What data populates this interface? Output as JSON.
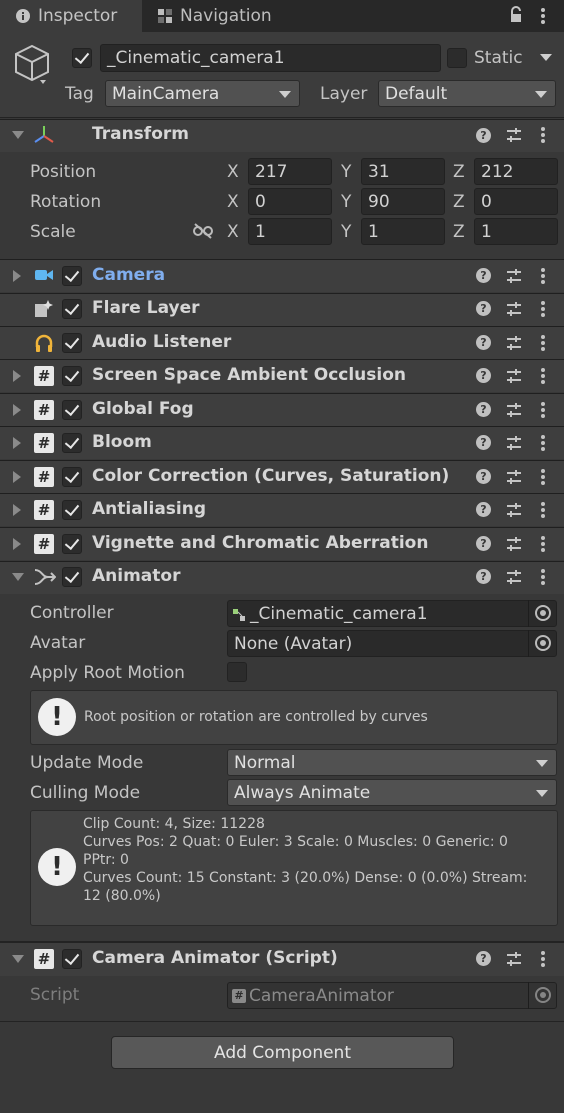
{
  "tabs": [
    {
      "label": "Inspector",
      "icon": "info-icon"
    },
    {
      "label": "Navigation",
      "icon": "navigation-icon"
    }
  ],
  "header": {
    "object_name": "_Cinematic_camera1",
    "static_label": "Static",
    "tag_label": "Tag",
    "tag_value": "MainCamera",
    "layer_label": "Layer",
    "layer_value": "Default"
  },
  "transform": {
    "title": "Transform",
    "rows": [
      {
        "label": "Position",
        "x": "217",
        "y": "31",
        "z": "212"
      },
      {
        "label": "Rotation",
        "x": "0",
        "y": "90",
        "z": "0"
      },
      {
        "label": "Scale",
        "x": "1",
        "y": "1",
        "z": "1"
      }
    ],
    "axis_x": "X",
    "axis_y": "Y",
    "axis_z": "Z"
  },
  "components": [
    {
      "title": "Camera",
      "icon": "camera-icon",
      "enabled": true,
      "highlight": true
    },
    {
      "title": "Flare Layer",
      "icon": "flare-layer-icon",
      "enabled": true
    },
    {
      "title": "Audio Listener",
      "icon": "headphones-icon",
      "enabled": true
    },
    {
      "title": "Screen Space Ambient Occlusion",
      "icon": "script-icon",
      "enabled": true
    },
    {
      "title": "Global Fog",
      "icon": "script-icon",
      "enabled": true
    },
    {
      "title": "Bloom",
      "icon": "script-icon",
      "enabled": true
    },
    {
      "title": "Color Correction (Curves, Saturation)",
      "icon": "script-icon",
      "enabled": true
    },
    {
      "title": "Antialiasing",
      "icon": "script-icon",
      "enabled": true
    },
    {
      "title": "Vignette and Chromatic Aberration",
      "icon": "script-icon",
      "enabled": true
    }
  ],
  "animator": {
    "title": "Animator",
    "controller_label": "Controller",
    "controller_value": "_Cinematic_camera1",
    "avatar_label": "Avatar",
    "avatar_value": "None (Avatar)",
    "apply_root_motion_label": "Apply Root Motion",
    "root_info": "Root position or rotation are controlled by curves",
    "update_mode_label": "Update Mode",
    "update_mode_value": "Normal",
    "culling_mode_label": "Culling Mode",
    "culling_mode_value": "Always Animate",
    "stats_line1": "Clip Count: 4, Size: 11228",
    "stats_line2": "Curves Pos: 2 Quat: 0 Euler: 3 Scale: 0 Muscles: 0 Generic: 0",
    "stats_line3": "PPtr: 0",
    "stats_line4": "Curves Count: 15 Constant: 3 (20.0%) Dense: 0 (0.0%) Stream:",
    "stats_line5": "12 (80.0%)"
  },
  "camera_animator": {
    "title": "Camera Animator (Script)",
    "script_label": "Script",
    "script_value": "CameraAnimator"
  },
  "add_component_label": "Add Component",
  "colors": {
    "background": "#383838",
    "highlight_title": "#80aeee",
    "tabbar": "#282828"
  }
}
